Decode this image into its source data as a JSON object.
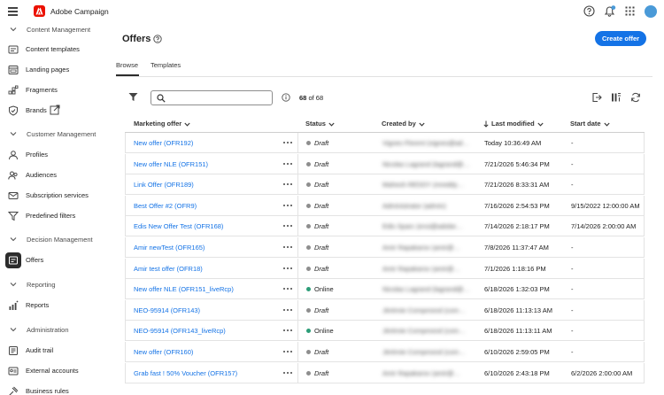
{
  "app": {
    "title": "Adobe Campaign"
  },
  "colors": {
    "accent": "#1473e6",
    "brand": "#eb1000",
    "draft": "#8e8e8e",
    "online": "#2d9d78"
  },
  "header_icons": [
    "help-icon",
    "bell-icon",
    "apps-grid-icon",
    "avatar"
  ],
  "sidebar": {
    "sections": [
      {
        "label": "Content Management",
        "items": [
          {
            "label": "Content templates",
            "icon": "content-templates-icon"
          },
          {
            "label": "Landing pages",
            "icon": "landing-pages-icon"
          },
          {
            "label": "Fragments",
            "icon": "fragments-icon"
          },
          {
            "label": "Brands",
            "icon": "brands-icon"
          }
        ]
      },
      {
        "label": "Customer Management",
        "items": [
          {
            "label": "Profiles",
            "icon": "profiles-icon"
          },
          {
            "label": "Audiences",
            "icon": "audiences-icon"
          },
          {
            "label": "Subscription services",
            "icon": "subscription-services-icon"
          },
          {
            "label": "Predefined filters",
            "icon": "predefined-filters-icon"
          }
        ]
      },
      {
        "label": "Decision Management",
        "items": [
          {
            "label": "Offers",
            "icon": "offers-icon",
            "active": true
          }
        ]
      },
      {
        "label": "Reporting",
        "items": [
          {
            "label": "Reports",
            "icon": "reports-icon"
          }
        ]
      },
      {
        "label": "Administration",
        "items": [
          {
            "label": "Audit trail",
            "icon": "audit-trail-icon"
          },
          {
            "label": "External accounts",
            "icon": "external-accounts-icon"
          },
          {
            "label": "Business rules",
            "icon": "business-rules-icon"
          }
        ]
      }
    ]
  },
  "main": {
    "title": "Offers",
    "create_button": "Create offer",
    "tabs": [
      {
        "label": "Browse",
        "active": true
      },
      {
        "label": "Templates",
        "active": false
      }
    ],
    "search": {
      "value": "",
      "placeholder": ""
    },
    "count": {
      "shown": "68",
      "sep": "of",
      "total": "68"
    },
    "columns": [
      "Marketing offer",
      "Status",
      "Created by",
      "Last modified",
      "Start date"
    ],
    "rows": [
      {
        "offer": "New offer (OFR192)",
        "status": "Draft",
        "created_by": "Vignes Florent (vignes@ad…",
        "modified": "Today 10:36:49 AM",
        "start": "-"
      },
      {
        "offer": "New offer NLE (OFR151)",
        "status": "Draft",
        "created_by": "Nicolas Lagrand (lagrand@…",
        "modified": "7/21/2026 5:46:34 PM",
        "start": "-"
      },
      {
        "offer": "Link Offer (OFR189)",
        "status": "Draft",
        "created_by": "Mahesh REDDY (mreddy…",
        "modified": "7/21/2026 8:33:31 AM",
        "start": "-"
      },
      {
        "offer": "Best Offer #2 (OFR9)",
        "status": "Draft",
        "created_by": "Administrator (admin)",
        "modified": "7/16/2026 2:54:53 PM",
        "start": "9/15/2022 12:00:00 AM"
      },
      {
        "offer": "Edis New Offer Test (OFR168)",
        "status": "Draft",
        "created_by": "Edis Sparc (ensi@adobe…",
        "modified": "7/14/2026 2:18:17 PM",
        "start": "7/14/2026 2:00:00 AM"
      },
      {
        "offer": "Amir newTest (OFR165)",
        "status": "Draft",
        "created_by": "Amir Rapakarov (amir@…",
        "modified": "7/8/2026 11:37:47 AM",
        "start": "-"
      },
      {
        "offer": "Amir test offer (OFR18)",
        "status": "Draft",
        "created_by": "Amir Rapakarov (amir@…",
        "modified": "7/1/2026 1:18:16 PM",
        "start": "-"
      },
      {
        "offer": "New offer NLE (OFR151_liveRcp)",
        "status": "Online",
        "created_by": "Nicolas Lagrand (lagrand@…",
        "modified": "6/18/2026 1:32:03 PM",
        "start": "-"
      },
      {
        "offer": "NEO-95914 (OFR143)",
        "status": "Draft",
        "created_by": "Jérémie Compmond (com…",
        "modified": "6/18/2026 11:13:13 AM",
        "start": "-"
      },
      {
        "offer": "NEO-95914 (OFR143_liveRcp)",
        "status": "Online",
        "created_by": "Jérémie Compmond (com…",
        "modified": "6/18/2026 11:13:11 AM",
        "start": "-"
      },
      {
        "offer": "New offer (OFR160)",
        "status": "Draft",
        "created_by": "Jérémie Compmond (com…",
        "modified": "6/10/2026 2:59:05 PM",
        "start": "-"
      },
      {
        "offer": "Grab fast ! 50% Voucher (OFR157)",
        "status": "Draft",
        "created_by": "Amir Rapakarov (amir@…",
        "modified": "6/10/2026 2:43:18 PM",
        "start": "6/2/2026 2:00:00 AM"
      }
    ]
  }
}
